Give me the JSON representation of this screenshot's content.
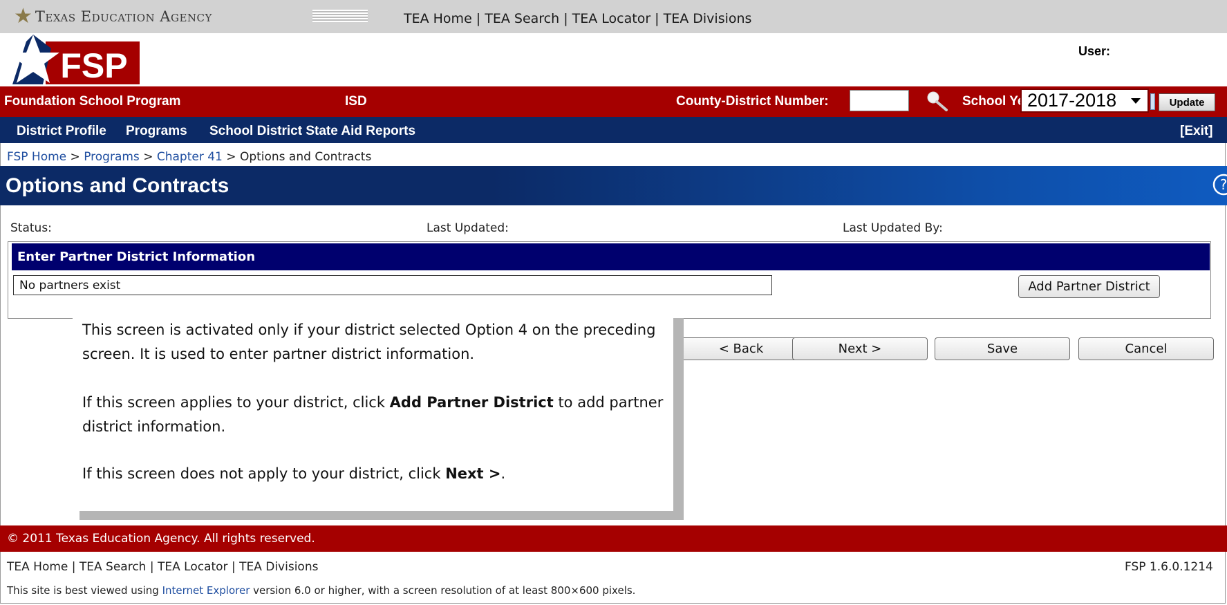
{
  "tea_bar": {
    "agency_name": "Texas Education Agency",
    "links": "TEA Home | TEA Search | TEA Locator | TEA Divisions"
  },
  "logo": {
    "text": "FSP"
  },
  "user": {
    "label": "User:"
  },
  "header": {
    "program": "Foundation School Program",
    "district": "ISD",
    "county_label": "County-District Number:",
    "county_value": "",
    "school_year_label": "School Ye",
    "school_year_value": "2017-2018",
    "update_label": "Update"
  },
  "nav": {
    "items": [
      {
        "label": "District Profile"
      },
      {
        "label": "Programs"
      },
      {
        "label": "School District State Aid Reports"
      }
    ],
    "exit_label": "[Exit]"
  },
  "breadcrumb": {
    "items": [
      "FSP Home",
      "Programs",
      "Chapter 41",
      "Options and Contracts"
    ],
    "separator": " > "
  },
  "page": {
    "title": "Options and Contracts"
  },
  "status": {
    "status_label": "Status:",
    "updated_label": "Last Updated:",
    "updated_by_label": "Last Updated By:"
  },
  "partner": {
    "title": "Enter Partner District Information",
    "empty_text": "No partners exist",
    "add_label": "Add Partner District"
  },
  "actions": {
    "back": "< Back",
    "next": "Next >",
    "save": "Save",
    "cancel": "Cancel"
  },
  "callout": {
    "p1": "This screen is activated only if your district selected Option 4 on the preceding screen. It is used to enter partner district information.",
    "p2_pre": "If this screen applies to your district, click ",
    "p2_bold": "Add Partner District",
    "p2_post": " to add partner district information.",
    "p3_pre": "If this screen does not apply to your district, click ",
    "p3_bold": "Next >",
    "p3_post": "."
  },
  "footer": {
    "copyright": "© 2011 Texas Education Agency. All rights reserved.",
    "links": "TEA Home | TEA Search | TEA Locator | TEA Divisions",
    "version": "FSP 1.6.0.1214",
    "best_pre": "This site is best viewed using ",
    "best_link": "Internet Explorer",
    "best_post": " version 6.0 or higher, with a screen resolution of at least 800×600 pixels."
  },
  "colors": {
    "header_red": "#a50000",
    "nav_blue": "#0c2a66",
    "panel_header": "#00006e",
    "link_blue": "#1f4ea0"
  },
  "icons": [
    "star-icon",
    "search-icon",
    "help-icon",
    "chevron-down-icon"
  ]
}
